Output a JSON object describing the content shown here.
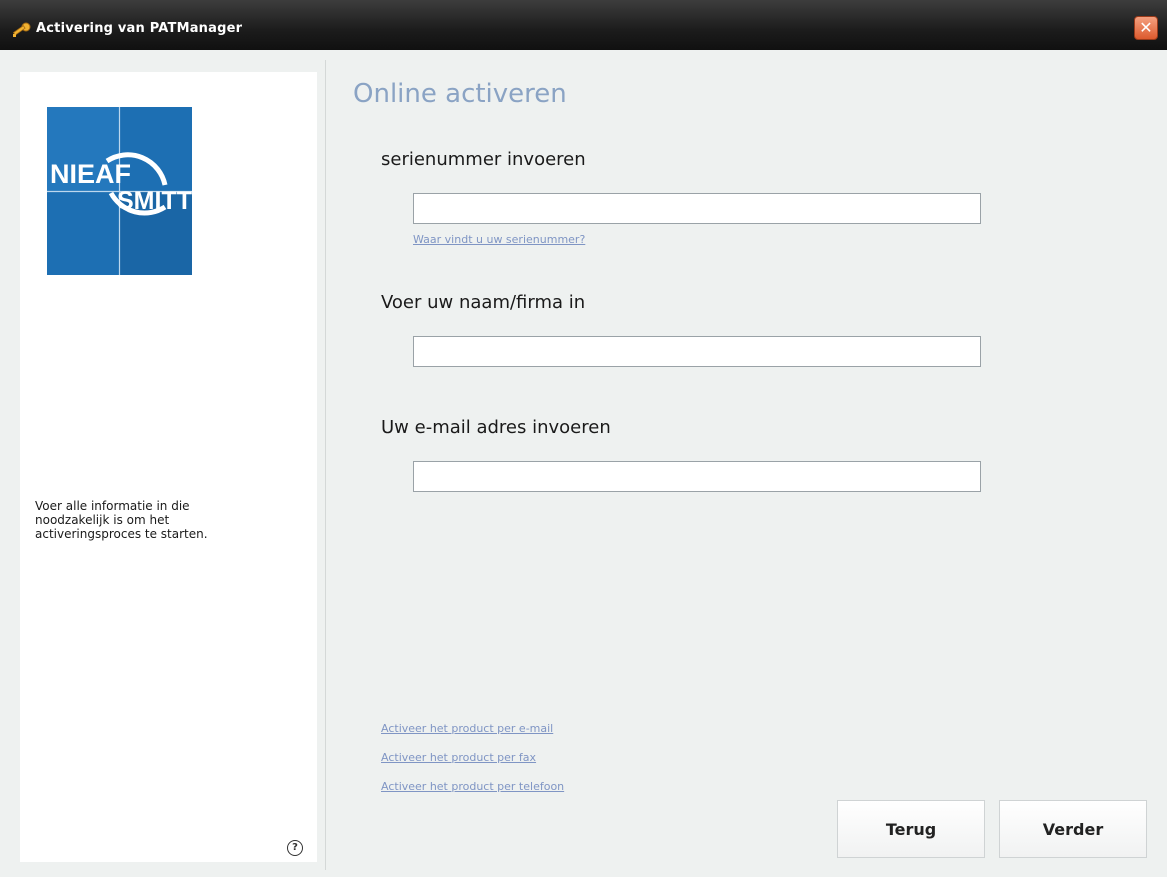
{
  "window": {
    "title": "Activering van PATManager",
    "close_glyph": "✕"
  },
  "sidebar": {
    "logo_text_top": "NIEAF",
    "logo_text_bottom": "SMITT",
    "info_text": "Voer alle informatie in die\nnoodzakelijk is om het\nactiveringsproces te starten.",
    "help_glyph": "?"
  },
  "main": {
    "title": "Online activeren",
    "serial": {
      "label": "serienummer invoeren",
      "value": "",
      "help_link": "Waar vindt u uw serienummer?"
    },
    "name": {
      "label": "Voer uw naam/firma in",
      "value": ""
    },
    "email": {
      "label": "Uw e-mail adres invoeren",
      "value": ""
    },
    "alt_links": [
      "Activeer het product per e-mail",
      "Activeer het product per fax",
      "Activeer het product per telefoon"
    ]
  },
  "buttons": {
    "back": "Terug",
    "next": "Verder"
  },
  "colors": {
    "title_blue": "#8aa3c4",
    "link_blue": "#7f95c4",
    "logo_blue": "#1d6fb3",
    "background": "#eef1f0"
  }
}
